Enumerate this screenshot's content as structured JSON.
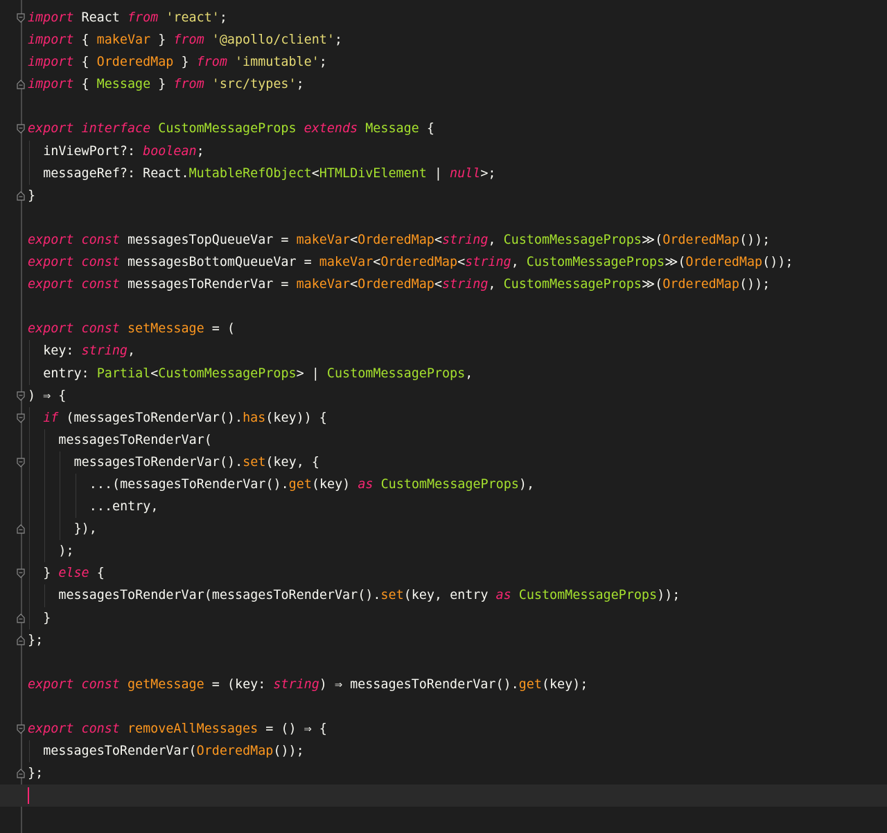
{
  "editor": {
    "language": "typescript",
    "theme": {
      "background": "#1e1e1e",
      "keyword": "#f92672",
      "string": "#e6db74",
      "type": "#a6e22e",
      "function": "#fd971f",
      "plain": "#f8f8f2"
    },
    "lines": [
      {
        "fold": "start",
        "indent": 0,
        "tokens": [
          [
            "kw",
            "import"
          ],
          [
            "pl",
            " React "
          ],
          [
            "kw",
            "from"
          ],
          [
            "pl",
            " "
          ],
          [
            "str",
            "'react'"
          ],
          [
            "pl",
            ";"
          ]
        ]
      },
      {
        "fold": "",
        "indent": 0,
        "tokens": [
          [
            "kw",
            "import"
          ],
          [
            "pl",
            " { "
          ],
          [
            "fn",
            "makeVar"
          ],
          [
            "pl",
            " } "
          ],
          [
            "kw",
            "from"
          ],
          [
            "pl",
            " "
          ],
          [
            "str",
            "'@apollo/client'"
          ],
          [
            "pl",
            ";"
          ]
        ]
      },
      {
        "fold": "",
        "indent": 0,
        "tokens": [
          [
            "kw",
            "import"
          ],
          [
            "pl",
            " { "
          ],
          [
            "fn",
            "OrderedMap"
          ],
          [
            "pl",
            " } "
          ],
          [
            "kw",
            "from"
          ],
          [
            "pl",
            " "
          ],
          [
            "str",
            "'immutable'"
          ],
          [
            "pl",
            ";"
          ]
        ]
      },
      {
        "fold": "end",
        "indent": 0,
        "tokens": [
          [
            "kw",
            "import"
          ],
          [
            "pl",
            " { "
          ],
          [
            "ty",
            "Message"
          ],
          [
            "pl",
            " } "
          ],
          [
            "kw",
            "from"
          ],
          [
            "pl",
            " "
          ],
          [
            "str",
            "'src/types'"
          ],
          [
            "pl",
            ";"
          ]
        ]
      },
      {
        "fold": "",
        "indent": 0,
        "tokens": []
      },
      {
        "fold": "start",
        "indent": 0,
        "tokens": [
          [
            "kw",
            "export"
          ],
          [
            "pl",
            " "
          ],
          [
            "kw",
            "interface"
          ],
          [
            "pl",
            " "
          ],
          [
            "ty",
            "CustomMessageProps"
          ],
          [
            "pl",
            " "
          ],
          [
            "kw",
            "extends"
          ],
          [
            "pl",
            " "
          ],
          [
            "ty",
            "Message"
          ],
          [
            "pl",
            " {"
          ]
        ]
      },
      {
        "fold": "",
        "indent": 1,
        "tokens": [
          [
            "pl",
            "inViewPort?: "
          ],
          [
            "kw",
            "boolean"
          ],
          [
            "pl",
            ";"
          ]
        ]
      },
      {
        "fold": "",
        "indent": 1,
        "tokens": [
          [
            "pl",
            "messageRef?: React."
          ],
          [
            "ty",
            "MutableRefObject"
          ],
          [
            "pl",
            "<"
          ],
          [
            "ty",
            "HTMLDivElement"
          ],
          [
            "pl",
            " | "
          ],
          [
            "kw",
            "null"
          ],
          [
            "pl",
            ">;"
          ]
        ]
      },
      {
        "fold": "end",
        "indent": 0,
        "tokens": [
          [
            "pl",
            "}"
          ]
        ]
      },
      {
        "fold": "",
        "indent": 0,
        "tokens": []
      },
      {
        "fold": "",
        "indent": 0,
        "tokens": [
          [
            "kw",
            "export"
          ],
          [
            "pl",
            " "
          ],
          [
            "kw",
            "const"
          ],
          [
            "pl",
            " messagesTopQueueVar = "
          ],
          [
            "fn",
            "makeVar"
          ],
          [
            "pl",
            "<"
          ],
          [
            "fn",
            "OrderedMap"
          ],
          [
            "pl",
            "<"
          ],
          [
            "kw",
            "string"
          ],
          [
            "pl",
            ", "
          ],
          [
            "ty",
            "CustomMessageProps"
          ],
          [
            "pl",
            "≫("
          ],
          [
            "fn",
            "OrderedMap"
          ],
          [
            "pl",
            "());"
          ]
        ]
      },
      {
        "fold": "",
        "indent": 0,
        "tokens": [
          [
            "kw",
            "export"
          ],
          [
            "pl",
            " "
          ],
          [
            "kw",
            "const"
          ],
          [
            "pl",
            " messagesBottomQueueVar = "
          ],
          [
            "fn",
            "makeVar"
          ],
          [
            "pl",
            "<"
          ],
          [
            "fn",
            "OrderedMap"
          ],
          [
            "pl",
            "<"
          ],
          [
            "kw",
            "string"
          ],
          [
            "pl",
            ", "
          ],
          [
            "ty",
            "CustomMessageProps"
          ],
          [
            "pl",
            "≫("
          ],
          [
            "fn",
            "OrderedMap"
          ],
          [
            "pl",
            "());"
          ]
        ]
      },
      {
        "fold": "",
        "indent": 0,
        "tokens": [
          [
            "kw",
            "export"
          ],
          [
            "pl",
            " "
          ],
          [
            "kw",
            "const"
          ],
          [
            "pl",
            " messagesToRenderVar = "
          ],
          [
            "fn",
            "makeVar"
          ],
          [
            "pl",
            "<"
          ],
          [
            "fn",
            "OrderedMap"
          ],
          [
            "pl",
            "<"
          ],
          [
            "kw",
            "string"
          ],
          [
            "pl",
            ", "
          ],
          [
            "ty",
            "CustomMessageProps"
          ],
          [
            "pl",
            "≫("
          ],
          [
            "fn",
            "OrderedMap"
          ],
          [
            "pl",
            "());"
          ]
        ]
      },
      {
        "fold": "",
        "indent": 0,
        "tokens": []
      },
      {
        "fold": "",
        "indent": 0,
        "tokens": [
          [
            "kw",
            "export"
          ],
          [
            "pl",
            " "
          ],
          [
            "kw",
            "const"
          ],
          [
            "pl",
            " "
          ],
          [
            "fn",
            "setMessage"
          ],
          [
            "pl",
            " = ("
          ]
        ]
      },
      {
        "fold": "",
        "indent": 1,
        "tokens": [
          [
            "pl",
            "key: "
          ],
          [
            "kw",
            "string"
          ],
          [
            "pl",
            ","
          ]
        ]
      },
      {
        "fold": "",
        "indent": 1,
        "tokens": [
          [
            "pl",
            "entry: "
          ],
          [
            "ty",
            "Partial"
          ],
          [
            "pl",
            "<"
          ],
          [
            "ty",
            "CustomMessageProps"
          ],
          [
            "pl",
            "> | "
          ],
          [
            "ty",
            "CustomMessageProps"
          ],
          [
            "pl",
            ","
          ]
        ]
      },
      {
        "fold": "start",
        "indent": 0,
        "tokens": [
          [
            "pl",
            ") ⇒ {"
          ]
        ]
      },
      {
        "fold": "start",
        "indent": 1,
        "tokens": [
          [
            "kw",
            "if"
          ],
          [
            "pl",
            " (messagesToRenderVar()."
          ],
          [
            "fn",
            "has"
          ],
          [
            "pl",
            "(key)) {"
          ]
        ]
      },
      {
        "fold": "",
        "indent": 2,
        "tokens": [
          [
            "pl",
            "messagesToRenderVar("
          ]
        ]
      },
      {
        "fold": "start",
        "indent": 3,
        "tokens": [
          [
            "pl",
            "messagesToRenderVar()."
          ],
          [
            "fn",
            "set"
          ],
          [
            "pl",
            "(key, {"
          ]
        ]
      },
      {
        "fold": "",
        "indent": 4,
        "tokens": [
          [
            "pl",
            "...(messagesToRenderVar()."
          ],
          [
            "fn",
            "get"
          ],
          [
            "pl",
            "(key) "
          ],
          [
            "kw",
            "as"
          ],
          [
            "pl",
            " "
          ],
          [
            "ty",
            "CustomMessageProps"
          ],
          [
            "pl",
            "),"
          ]
        ]
      },
      {
        "fold": "",
        "indent": 4,
        "tokens": [
          [
            "pl",
            "...entry,"
          ]
        ]
      },
      {
        "fold": "end",
        "indent": 3,
        "tokens": [
          [
            "pl",
            "}),"
          ]
        ]
      },
      {
        "fold": "",
        "indent": 2,
        "tokens": [
          [
            "pl",
            ");"
          ]
        ]
      },
      {
        "fold": "start",
        "indent": 1,
        "tokens": [
          [
            "pl",
            "} "
          ],
          [
            "kw",
            "else"
          ],
          [
            "pl",
            " {"
          ]
        ]
      },
      {
        "fold": "",
        "indent": 2,
        "tokens": [
          [
            "pl",
            "messagesToRenderVar(messagesToRenderVar()."
          ],
          [
            "fn",
            "set"
          ],
          [
            "pl",
            "(key, entry "
          ],
          [
            "kw",
            "as"
          ],
          [
            "pl",
            " "
          ],
          [
            "ty",
            "CustomMessageProps"
          ],
          [
            "pl",
            "));"
          ]
        ]
      },
      {
        "fold": "end",
        "indent": 1,
        "tokens": [
          [
            "pl",
            "}"
          ]
        ]
      },
      {
        "fold": "end",
        "indent": 0,
        "tokens": [
          [
            "pl",
            "};"
          ]
        ]
      },
      {
        "fold": "",
        "indent": 0,
        "tokens": []
      },
      {
        "fold": "",
        "indent": 0,
        "tokens": [
          [
            "kw",
            "export"
          ],
          [
            "pl",
            " "
          ],
          [
            "kw",
            "const"
          ],
          [
            "pl",
            " "
          ],
          [
            "fn",
            "getMessage"
          ],
          [
            "pl",
            " = (key: "
          ],
          [
            "kw",
            "string"
          ],
          [
            "pl",
            ") ⇒ messagesToRenderVar()."
          ],
          [
            "fn",
            "get"
          ],
          [
            "pl",
            "(key);"
          ]
        ]
      },
      {
        "fold": "",
        "indent": 0,
        "tokens": []
      },
      {
        "fold": "start",
        "indent": 0,
        "tokens": [
          [
            "kw",
            "export"
          ],
          [
            "pl",
            " "
          ],
          [
            "kw",
            "const"
          ],
          [
            "pl",
            " "
          ],
          [
            "fn",
            "removeAllMessages"
          ],
          [
            "pl",
            " = () ⇒ {"
          ]
        ]
      },
      {
        "fold": "",
        "indent": 1,
        "tokens": [
          [
            "pl",
            "messagesToRenderVar("
          ],
          [
            "fn",
            "OrderedMap"
          ],
          [
            "pl",
            "());"
          ]
        ]
      },
      {
        "fold": "end",
        "indent": 0,
        "tokens": [
          [
            "pl",
            "};"
          ]
        ]
      },
      {
        "fold": "",
        "indent": 0,
        "tokens": [],
        "current": true
      }
    ]
  }
}
